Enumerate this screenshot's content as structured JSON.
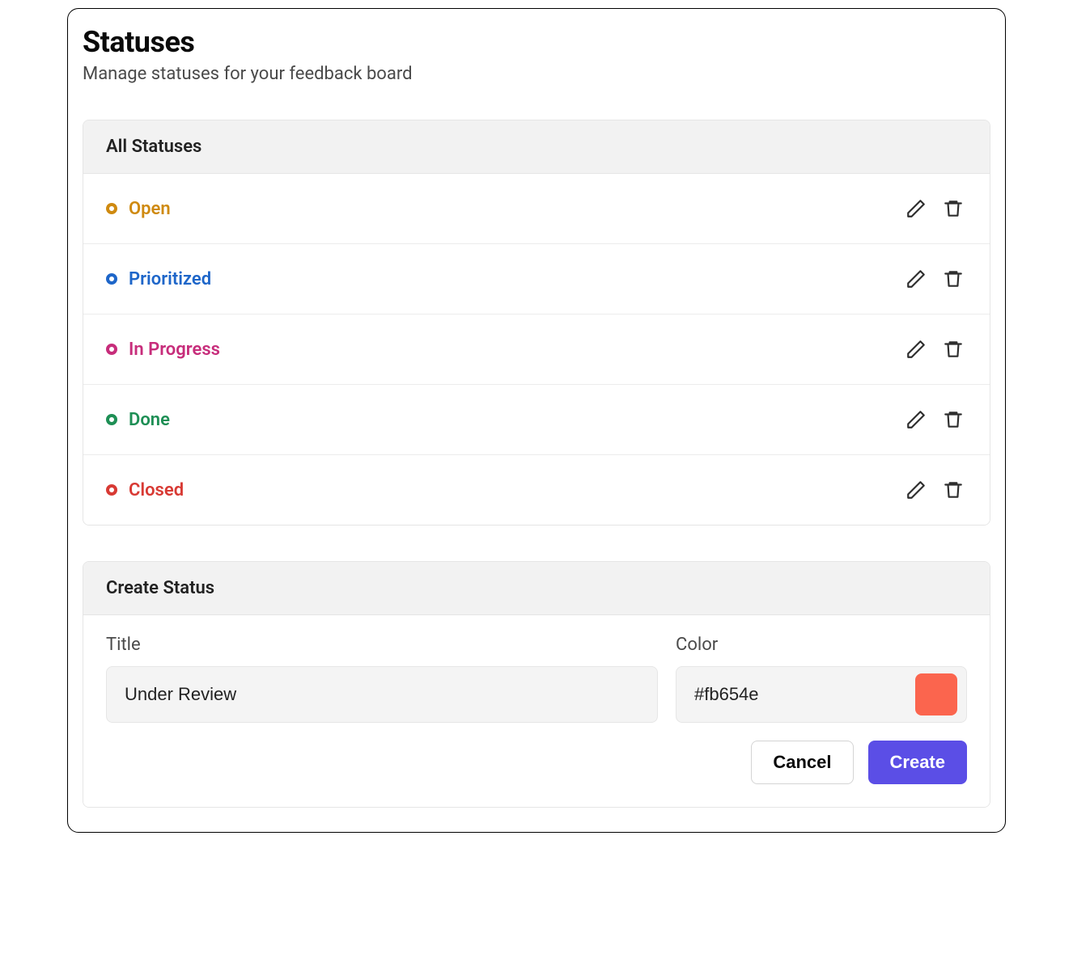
{
  "header": {
    "title": "Statuses",
    "subtitle": "Manage statuses for your feedback board"
  },
  "list": {
    "heading": "All Statuses",
    "items": [
      {
        "label": "Open",
        "color": "#cf8a10"
      },
      {
        "label": "Prioritized",
        "color": "#1e66c9"
      },
      {
        "label": "In Progress",
        "color": "#c72d7b"
      },
      {
        "label": "Done",
        "color": "#1e8f55"
      },
      {
        "label": "Closed",
        "color": "#d83a34"
      }
    ]
  },
  "create": {
    "heading": "Create Status",
    "title_label": "Title",
    "title_value": "Under Review",
    "color_label": "Color",
    "color_value": "#fb654e",
    "swatch_color": "#fb654e",
    "cancel_label": "Cancel",
    "submit_label": "Create"
  }
}
